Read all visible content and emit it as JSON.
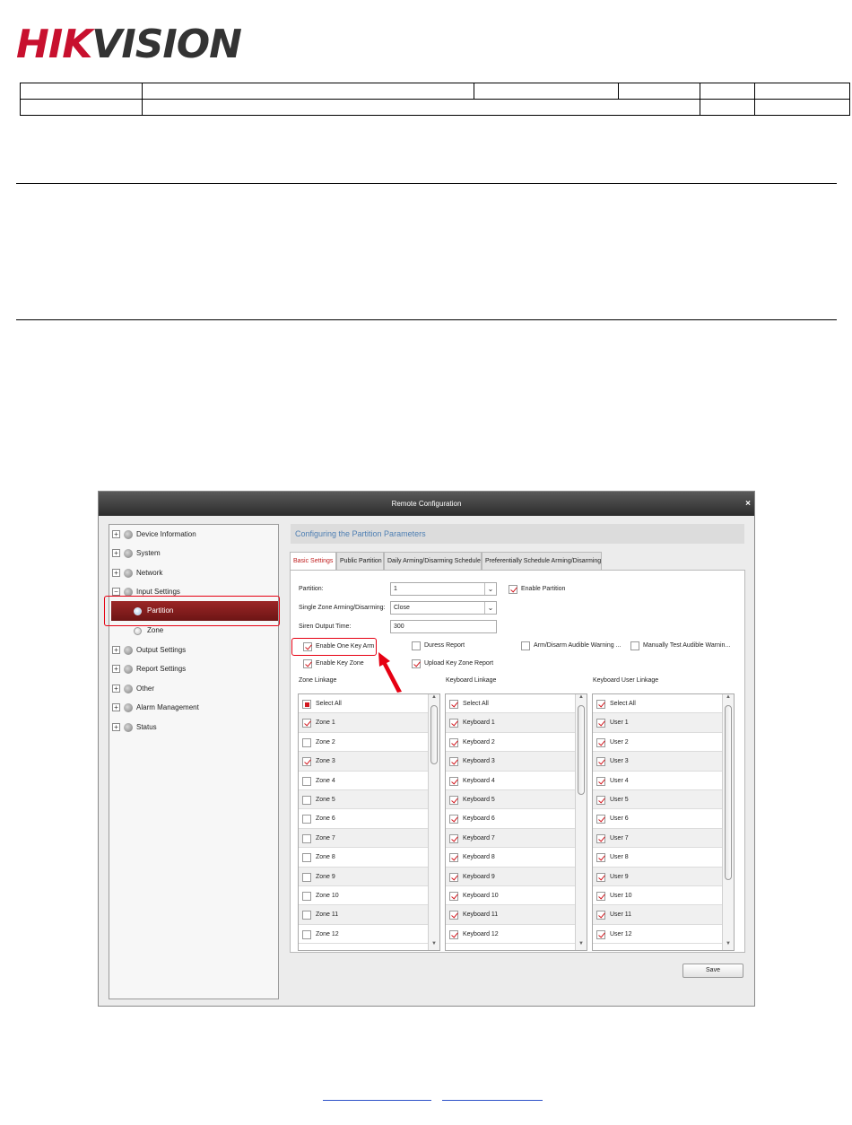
{
  "logo": {
    "part1": "HIK",
    "part2": "VISION"
  },
  "dialog": {
    "title": "Remote Configuration",
    "close_symbol": "×",
    "header": "Configuring the Partition Parameters",
    "tree": [
      {
        "label": "Device Information",
        "toggle": "+"
      },
      {
        "label": "System",
        "toggle": "+"
      },
      {
        "label": "Network",
        "toggle": "+"
      },
      {
        "label": "Input Settings",
        "toggle": "−"
      },
      {
        "label": "Partition"
      },
      {
        "label": "Zone"
      },
      {
        "label": "Output Settings",
        "toggle": "+"
      },
      {
        "label": "Report Settings",
        "toggle": "+"
      },
      {
        "label": "Other",
        "toggle": "+"
      },
      {
        "label": "Alarm Management",
        "toggle": "+"
      },
      {
        "label": "Status",
        "toggle": "+"
      }
    ],
    "tabs": [
      "Basic Settings",
      "Public Partition",
      "Daily Arming/Disarming Schedule",
      "Preferentially Schedule Arming/Disarming"
    ],
    "form": {
      "partition_label": "Partition:",
      "partition_value": "1",
      "enable_partition": "Enable Partition",
      "single_zone_label": "Single Zone Arming/Disarming:",
      "single_zone_value": "Close",
      "siren_label": "Siren Output Time:",
      "siren_value": "300",
      "dropdown_arrow": "⌄"
    },
    "options": {
      "enable_one_key_arm": "Enable One Key Arm",
      "duress_report": "Duress Report",
      "arm_disarm_audible": "Arm/Disarm Audible Warning ...",
      "manually_test_audible": "Manually Test Audible Warnin...",
      "enable_key_zone": "Enable Key Zone",
      "upload_key_zone_report": "Upload Key Zone Report"
    },
    "zone_linkage": {
      "title": "Zone Linkage",
      "select_all": "Select All",
      "items": [
        "Zone 1",
        "Zone 2",
        "Zone 3",
        "Zone 4",
        "Zone 5",
        "Zone 6",
        "Zone 7",
        "Zone 8",
        "Zone 9",
        "Zone 10",
        "Zone 11",
        "Zone 12"
      ],
      "checked": [
        true,
        false,
        true,
        false,
        false,
        false,
        false,
        false,
        false,
        false,
        false,
        false
      ]
    },
    "keyboard_linkage": {
      "title": "Keyboard Linkage",
      "select_all": "Select All",
      "items": [
        "Keyboard 1",
        "Keyboard 2",
        "Keyboard 3",
        "Keyboard 4",
        "Keyboard 5",
        "Keyboard 6",
        "Keyboard 7",
        "Keyboard 8",
        "Keyboard 9",
        "Keyboard 10",
        "Keyboard 11",
        "Keyboard 12"
      ],
      "checked": [
        true,
        true,
        true,
        true,
        true,
        true,
        true,
        true,
        true,
        true,
        true,
        true
      ]
    },
    "keyboard_user_linkage": {
      "title": "Keyboard User Linkage",
      "select_all": "Select All",
      "items": [
        "User 1",
        "User 2",
        "User 3",
        "User 4",
        "User 5",
        "User 6",
        "User 7",
        "User 8",
        "User 9",
        "User 10",
        "User 11",
        "User 12"
      ],
      "checked": [
        true,
        true,
        true,
        true,
        true,
        true,
        true,
        true,
        true,
        true,
        true,
        true
      ]
    },
    "save_label": "Save",
    "scroll_up": "▲",
    "scroll_down": "▼"
  },
  "colors": {
    "brand_red": "#c8102e",
    "annotation_red": "#e60012",
    "header_blue": "#4e7fb3"
  }
}
